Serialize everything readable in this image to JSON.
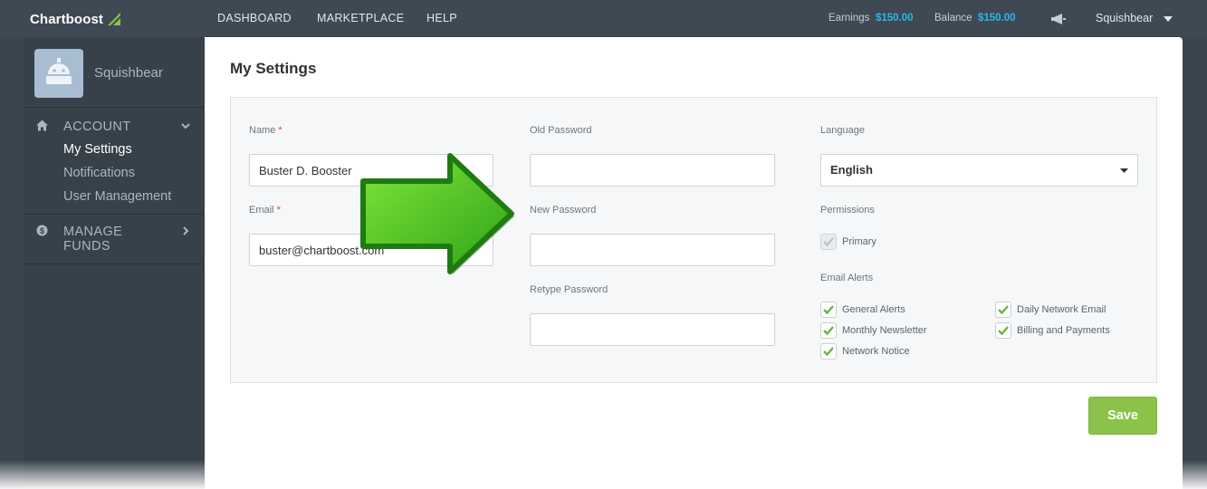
{
  "topbar": {
    "brand": "Chartboost",
    "nav": [
      "DASHBOARD",
      "MARKETPLACE",
      "HELP"
    ],
    "earnings_label": "Earnings",
    "earnings_value": "$150.00",
    "balance_label": "Balance",
    "balance_value": "$150.00",
    "user": "Squishbear"
  },
  "sidebar": {
    "profile_name": "Squishbear",
    "sections": [
      {
        "title": "ACCOUNT",
        "icon": "home-icon",
        "expanded": true,
        "items": [
          "My Settings",
          "Notifications",
          "User Management"
        ],
        "active_item": "My Settings"
      },
      {
        "title_line1": "MANAGE",
        "title_line2": "FUNDS",
        "icon": "dollar-icon",
        "expanded": false
      }
    ]
  },
  "settings": {
    "title": "My Settings",
    "name_label": "Name",
    "name_value": "Buster D. Booster",
    "email_label": "Email",
    "email_value": "buster@chartboost.com",
    "required_mark": "*",
    "old_password_label": "Old Password",
    "new_password_label": "New Password",
    "retype_password_label": "Retype Password",
    "language_label": "Language",
    "language_value": "English",
    "permissions_label": "Permissions",
    "permissions": [
      {
        "label": "Primary",
        "checked": true,
        "disabled": true
      }
    ],
    "email_alerts_label": "Email Alerts",
    "email_alerts": [
      {
        "label": "General Alerts",
        "checked": true
      },
      {
        "label": "Daily Network Email",
        "checked": true
      },
      {
        "label": "Monthly Newsletter",
        "checked": true
      },
      {
        "label": "Billing and Payments",
        "checked": true
      },
      {
        "label": "Network Notice",
        "checked": true
      }
    ],
    "save_label": "Save"
  },
  "colors": {
    "accent_blue": "#2ab7ea",
    "save_green": "#8bc34a",
    "check_green": "#6cb33f",
    "arrow_green": "#4cc41a",
    "required_red": "#e0453a"
  }
}
